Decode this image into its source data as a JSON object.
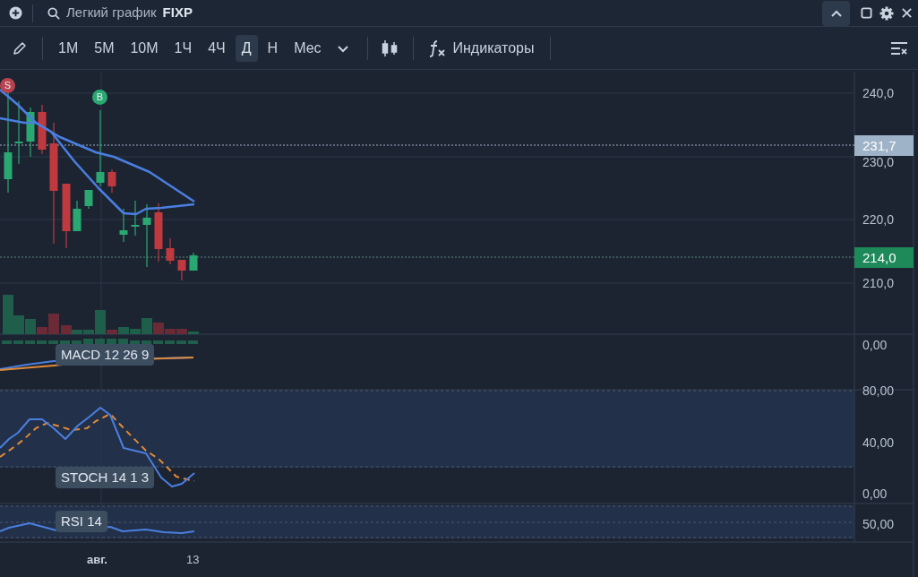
{
  "header": {
    "search_label": "Легкий график",
    "ticker": "FIXP"
  },
  "toolbar": {
    "timeframes": [
      {
        "label": "1М",
        "selected": false
      },
      {
        "label": "5М",
        "selected": false
      },
      {
        "label": "10М",
        "selected": false
      },
      {
        "label": "1Ч",
        "selected": false
      },
      {
        "label": "4Ч",
        "selected": false
      },
      {
        "label": "Д",
        "selected": true
      },
      {
        "label": "Н",
        "selected": false
      },
      {
        "label": "Мес",
        "selected": false
      }
    ],
    "indicators_button": "Индикаторы"
  },
  "chart": {
    "price_axis": [
      "240,0",
      "230,0",
      "220,0",
      "210,0"
    ],
    "price_markers": [
      {
        "label": "231,7",
        "color": "#9fb3c8"
      },
      {
        "label": "214,0",
        "color": "#1e8a5a"
      }
    ],
    "signals": [
      {
        "label": "S",
        "color": "#b8434f"
      },
      {
        "label": "B",
        "color": "#2aa872"
      }
    ],
    "panes": [
      {
        "label": "MACD 12 26 9",
        "axis": [
          "0,00"
        ]
      },
      {
        "label": "STOCH 14 1 3",
        "axis": [
          "80,00",
          "40,00",
          "0,00"
        ]
      },
      {
        "label": "RSI 14",
        "axis": [
          "50,00"
        ]
      }
    ],
    "time_axis": [
      "авг.",
      "13"
    ]
  }
}
